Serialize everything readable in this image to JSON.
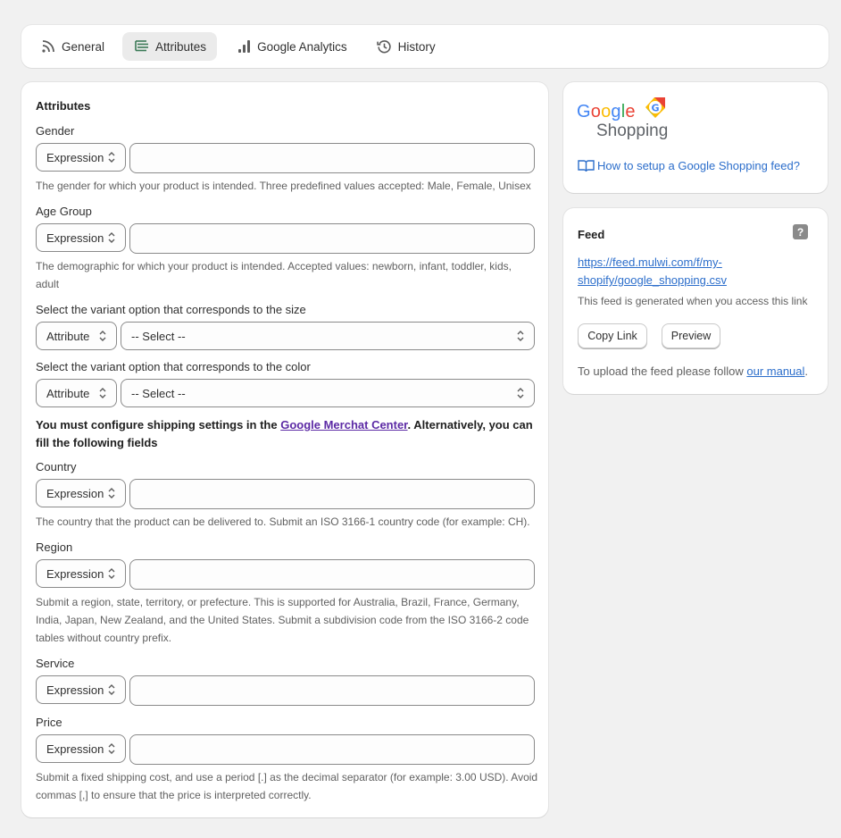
{
  "tabs": [
    {
      "label": "General",
      "icon": "rss-icon"
    },
    {
      "label": "Attributes",
      "icon": "list-icon"
    },
    {
      "label": "Google Analytics",
      "icon": "bar-chart-icon"
    },
    {
      "label": "History",
      "icon": "history-icon"
    }
  ],
  "main": {
    "title": "Attributes",
    "gender": {
      "label": "Gender",
      "type": "Expression",
      "value": "",
      "help": "The gender for which your product is intended. Three predefined values accepted: Male, Female, Unisex"
    },
    "age_group": {
      "label": "Age Group",
      "type": "Expression",
      "value": "",
      "help_line1": "The demographic for which your product is intended. Accepted values: newborn, infant, toddler, kids,",
      "help_line2": "adult"
    },
    "size": {
      "label": "Select the variant option that corresponds to the size",
      "type": "Attribute",
      "value": "-- Select --"
    },
    "color": {
      "label": "Select the variant option that corresponds to the color",
      "type": "Attribute",
      "value": "-- Select --"
    },
    "shipping_note": {
      "before": "You must configure shipping settings in the ",
      "link": "Google Merchat Center",
      "after_line1": ". Alternatively, you can",
      "line2": "fill the following fields"
    },
    "country": {
      "label": "Country",
      "type": "Expression",
      "value": "",
      "help": "The country that the product can be delivered to. Submit an ISO 3166-1 country code (for example: CH)."
    },
    "region": {
      "label": "Region",
      "type": "Expression",
      "value": "",
      "help_line1": "Submit a region, state, territory, or prefecture. This is supported for Australia, Brazil, France, Germany,",
      "help_line2": "India, Japan, New Zealand, and the United States. Submit a subdivision code from the ISO 3166-2 code",
      "help_line3": "tables without country prefix."
    },
    "service": {
      "label": "Service",
      "type": "Expression",
      "value": ""
    },
    "price": {
      "label": "Price",
      "type": "Expression",
      "value": "",
      "help_line1": "Submit a fixed shipping cost, and use a period [.] as the decimal separator (for example: 3.00 USD). Avoid",
      "help_line2": "commas [,] to ensure that the price is interpreted correctly."
    }
  },
  "logo": {
    "google": "Google",
    "shopping": "Shopping"
  },
  "setup_link": "How to setup a Google Shopping feed?",
  "feed": {
    "title": "Feed",
    "help_badge": "?",
    "url_line1": "https://feed.mulwi.com/f/my-",
    "url_line2": "shopify/google_shopping.csv",
    "note": "This feed is generated when you access this link",
    "copy_label": "Copy Link",
    "preview_label": "Preview",
    "upload_before": "To upload the feed please follow ",
    "upload_link": "our manual",
    "upload_after": "."
  },
  "colors": {
    "accent": "#2c6ecb",
    "active_tab": "#ebebeb",
    "visited_link": "#5c2aa5"
  }
}
